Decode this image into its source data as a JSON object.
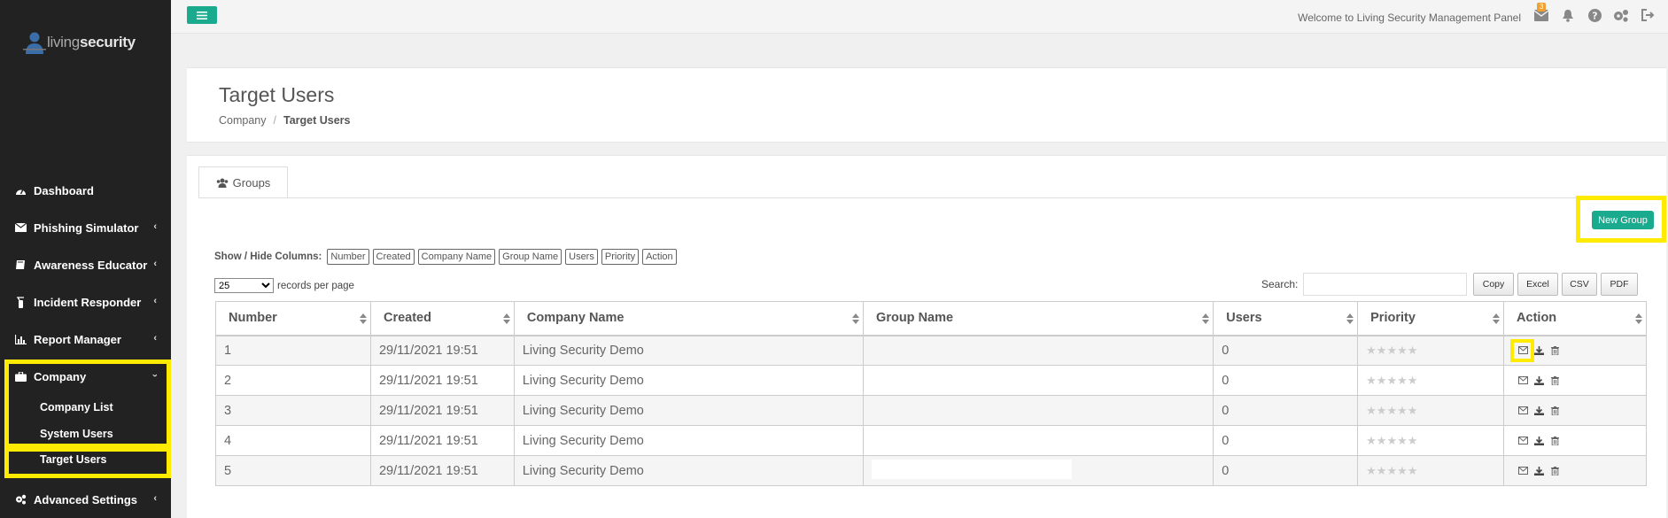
{
  "brand": {
    "name_light": "living",
    "name_bold": "security"
  },
  "sidebar": {
    "items": [
      {
        "label": "Dashboard",
        "icon": "dashboard-icon"
      },
      {
        "label": "Phishing Simulator",
        "icon": "envelope-icon"
      },
      {
        "label": "Awareness Educator",
        "icon": "book-icon"
      },
      {
        "label": "Incident Responder",
        "icon": "fire-extinguisher-icon"
      },
      {
        "label": "Report Manager",
        "icon": "bar-chart-icon"
      },
      {
        "label": "Company",
        "icon": "briefcase-icon"
      },
      {
        "label": "Advanced Settings",
        "icon": "cogs-icon"
      }
    ],
    "company_sub": [
      {
        "label": "Company List"
      },
      {
        "label": "System Users"
      },
      {
        "label": "Target Users"
      }
    ]
  },
  "topbar": {
    "welcome": "Welcome to Living Security Management Panel",
    "mail_count": "3"
  },
  "header": {
    "title": "Target Users",
    "breadcrumb": [
      "Company",
      "/",
      "Target Users"
    ]
  },
  "panel": {
    "tab_label": "Groups",
    "new_group_label": "New Group",
    "showhide_label": "Show / Hide Columns:",
    "column_toggles": [
      "Number",
      "Created",
      "Company Name",
      "Group Name",
      "Users",
      "Priority",
      "Action"
    ],
    "length_value": "25",
    "length_suffix": "records per page",
    "search_label": "Search:",
    "search_value": "",
    "export_buttons": [
      "Copy",
      "Excel",
      "CSV",
      "PDF"
    ]
  },
  "table": {
    "headers": [
      "Number",
      "Created",
      "Company Name",
      "Group Name",
      "Users",
      "Priority",
      "Action"
    ],
    "rows": [
      {
        "number": "1",
        "created": "29/11/2021 19:51",
        "company": "Living Security Demo",
        "group": "",
        "users": "0",
        "priority": "★★★★★"
      },
      {
        "number": "2",
        "created": "29/11/2021 19:51",
        "company": "Living Security Demo",
        "group": "",
        "users": "0",
        "priority": "★★★★★"
      },
      {
        "number": "3",
        "created": "29/11/2021 19:51",
        "company": "Living Security Demo",
        "group": "",
        "users": "0",
        "priority": "★★★★★"
      },
      {
        "number": "4",
        "created": "29/11/2021 19:51",
        "company": "Living Security Demo",
        "group": "",
        "users": "0",
        "priority": "★★★★★"
      },
      {
        "number": "5",
        "created": "29/11/2021 19:51",
        "company": "Living Security Demo",
        "group": "",
        "users": "0",
        "priority": "★★★★★"
      }
    ]
  },
  "colors": {
    "accent": "#1aaa8d",
    "sidebar": "#222222",
    "highlight": "#ffeb00"
  }
}
